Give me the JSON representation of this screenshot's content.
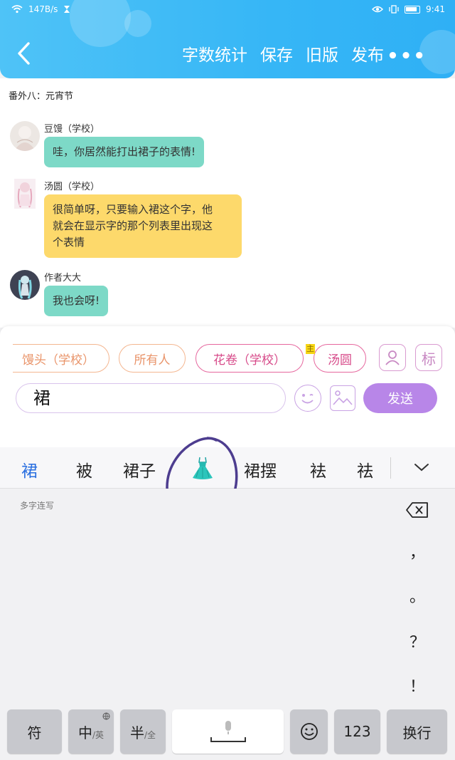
{
  "status_bar": {
    "speed": "147B/s",
    "time": "9:41"
  },
  "header": {
    "nav": [
      "字数统计",
      "保存",
      "旧版",
      "发布"
    ],
    "more": "•••"
  },
  "chapter_title": "番外八：元宵节",
  "messages": [
    {
      "sender": "豆馒（学校）",
      "text": "哇，你居然能打出裙子的表情!",
      "color": "#7dd9c7"
    },
    {
      "sender": "汤圆（学校）",
      "lines": [
        "很简单呀，只要输入裙这个字，他",
        "就会在显示字的那个列表里出现这",
        "个表情"
      ],
      "color": "#fdd96b"
    },
    {
      "sender": "作者大大",
      "text": "我也会呀!",
      "color": "#7dd9c7"
    }
  ],
  "roles": [
    "馒头（学校）",
    "所有人",
    "花卷（学校）",
    "汤圆"
  ],
  "role_marker": "主",
  "side_buttons": {
    "tag": "标"
  },
  "input": {
    "value": "裙"
  },
  "send_label": "发送",
  "candidates": [
    "裙",
    "被",
    "裙子",
    "👗",
    "裙摆",
    "袪",
    "祛"
  ],
  "keyboard": {
    "multi_label": "多字连写",
    "punctuation": [
      "，",
      "。",
      "？",
      "！"
    ],
    "keys": {
      "symbol": "符",
      "cn_main": "中",
      "cn_sub": "/英",
      "half_main": "半",
      "half_sub": "/全",
      "num": "123",
      "enter": "换行"
    }
  }
}
